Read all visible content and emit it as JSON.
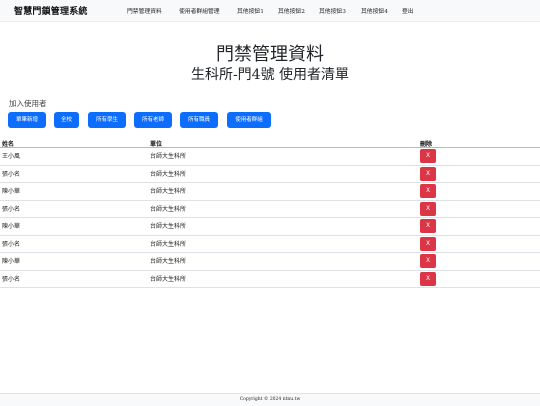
{
  "navbar": {
    "brand": "智慧門鎖管理系統",
    "links": [
      "門禁管理資料",
      "使用者群組管理",
      "其他按鈕1",
      "其他按鈕2",
      "其他按鈕3",
      "其他按鈕4",
      "登出"
    ]
  },
  "main": {
    "title": "門禁管理資料",
    "subtitle": "生科所-門4號 使用者清單",
    "add_label": "加入使用者",
    "buttons": [
      "單筆新增",
      "全校",
      "所有學生",
      "所有老師",
      "所有職員",
      "使用者群組"
    ]
  },
  "table": {
    "headers": [
      "姓名",
      "單位",
      "刪除"
    ],
    "delete_label": "X",
    "rows": [
      {
        "name": "王小風",
        "unit": "台師大生科所"
      },
      {
        "name": "張小名",
        "unit": "台師大生科所"
      },
      {
        "name": "陳小華",
        "unit": "台師大生科所"
      },
      {
        "name": "張小名",
        "unit": "台師大生科所"
      },
      {
        "name": "陳小華",
        "unit": "台師大生科所"
      },
      {
        "name": "張小名",
        "unit": "台師大生科所"
      },
      {
        "name": "陳小華",
        "unit": "台師大生科所"
      },
      {
        "name": "張小名",
        "unit": "台師大生科所"
      }
    ]
  },
  "footer": {
    "copyright": "Copyright © 2024 ntnu.tw"
  },
  "colors": {
    "primary": "#0d6efd",
    "danger": "#dc3545",
    "navbar_bg": "#f8f9fa"
  }
}
